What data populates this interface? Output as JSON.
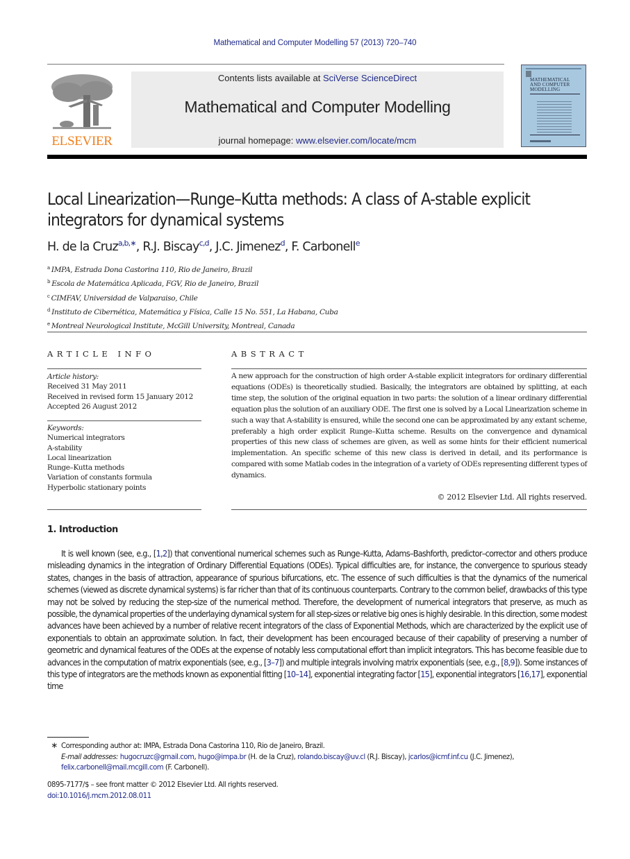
{
  "running_head": "Mathematical and Computer Modelling 57 (2013) 720–740",
  "masthead": {
    "publisher_logo": "ELSEVIER",
    "contents_prefix": "Contents lists available at ",
    "contents_link": "SciVerse ScienceDirect",
    "journal_title": "Mathematical and Computer Modelling",
    "homepage_prefix": "journal homepage: ",
    "homepage_link": "www.elsevier.com/locate/mcm",
    "cover_title_lines": [
      "MATHEMATICAL",
      "AND COMPUTER",
      "MODELLING"
    ],
    "colors": {
      "elsevier_orange": "#f07f1b",
      "link_blue": "#1f2a8a",
      "banner_gray": "#ececec",
      "cover_blue": "#a8c8e0"
    }
  },
  "article": {
    "title": "Local Linearization—Runge–Kutta methods: A class of A-stable explicit integrators for dynamical systems",
    "authors": [
      {
        "name": "H. de la Cruz",
        "sup": "a,b,∗",
        "sep": ", "
      },
      {
        "name": "R.J. Biscay",
        "sup": "c,d",
        "sep": ", "
      },
      {
        "name": "J.C. Jimenez",
        "sup": "d",
        "sep": ", "
      },
      {
        "name": "F. Carbonell",
        "sup": "e",
        "sep": ""
      }
    ],
    "affiliations": [
      {
        "mark": "a",
        "text": "IMPA, Estrada Dona Castorina 110, Rio de Janeiro, Brazil"
      },
      {
        "mark": "b",
        "text": "Escola de Matemática Aplicada, FGV, Rio de Janeiro, Brazil"
      },
      {
        "mark": "c",
        "text": "CIMFAV, Universidad de Valparaiso, Chile"
      },
      {
        "mark": "d",
        "text": "Instituto de Cibernética, Matemática y Física, Calle 15 No. 551, La Habana, Cuba"
      },
      {
        "mark": "e",
        "text": "Montreal Neurological Institute, McGill University, Montreal, Canada"
      }
    ]
  },
  "article_info": {
    "heading": "ARTICLE INFO",
    "history_label": "Article history:",
    "history": [
      "Received 31 May 2011",
      "Received in revised form 15 January 2012",
      "Accepted 26 August 2012"
    ],
    "keywords_label": "Keywords:",
    "keywords": [
      "Numerical integrators",
      "A-stability",
      "Local linearization",
      "Runge–Kutta methods",
      "Variation of constants formula",
      "Hyperbolic stationary points"
    ]
  },
  "abstract": {
    "heading": "ABSTRACT",
    "text": "A new approach for the construction of high order A-stable explicit integrators for ordinary differential equations (ODEs) is theoretically studied. Basically, the integrators are obtained by splitting, at each time step, the solution of the original equation in two parts: the solution of a linear ordinary differential equation plus the solution of an auxiliary ODE. The first one is solved by a Local Linearization scheme in such a way that A-stability is ensured, while the second one can be approximated by any extant scheme, preferably a high order explicit Runge–Kutta scheme. Results on the convergence and dynamical properties of this new class of schemes are given, as well as some hints for their efficient numerical implementation. An specific scheme of this new class is derived in detail, and its performance is compared with some Matlab codes in the integration of a variety of ODEs representing different types of dynamics.",
    "copyright": "© 2012 Elsevier Ltd. All rights reserved."
  },
  "introduction": {
    "heading": "1.  Introduction",
    "segments": [
      {
        "t": "It is well known (see, e.g., ["
      },
      {
        "t": "1",
        "ref": true
      },
      {
        "t": ","
      },
      {
        "t": "2",
        "ref": true
      },
      {
        "t": "]) that conventional numerical schemes such as Runge–Kutta, Adams–Bashforth, predictor–corrector and others produce misleading dynamics in the integration of Ordinary Differential Equations (ODEs). Typical difficulties are, for instance, the convergence to spurious steady states, changes in the basis of attraction, appearance of spurious bifurcations, etc. The essence of such difficulties is that the dynamics of the numerical schemes (viewed as discrete dynamical systems) is far richer than that of its continuous counterparts. Contrary to the common belief, drawbacks of this type may not be solved by reducing the step-size of the numerical method. Therefore, the development of numerical integrators that preserve, as much as possible, the dynamical properties of the underlaying dynamical system for all step-sizes or relative big ones is highly desirable. In this direction, some modest advances have been achieved by a number of relative recent integrators of the class of Exponential Methods, which are characterized by the explicit use of exponentials to obtain an approximate solution. In fact, their development has been encouraged because of their capability of preserving a number of geometric and dynamical features of the ODEs at the expense of notably less computational effort than implicit integrators. This has become feasible due to advances in the computation of matrix exponentials (see, e.g., ["
      },
      {
        "t": "3–7",
        "ref": true
      },
      {
        "t": "]) and multiple integrals involving matrix exponentials (see, e.g., ["
      },
      {
        "t": "8",
        "ref": true
      },
      {
        "t": ","
      },
      {
        "t": "9",
        "ref": true
      },
      {
        "t": "]). Some instances of this type of integrators are the methods known as exponential fitting ["
      },
      {
        "t": "10–14",
        "ref": true
      },
      {
        "t": "], exponential integrating factor ["
      },
      {
        "t": "15",
        "ref": true
      },
      {
        "t": "], exponential integrators ["
      },
      {
        "t": "16",
        "ref": true
      },
      {
        "t": ","
      },
      {
        "t": "17",
        "ref": true
      },
      {
        "t": "], exponential time"
      }
    ]
  },
  "footnotes": {
    "star": "∗",
    "corresponding": "Corresponding author at: IMPA, Estrada Dona Castorina 110, Rio de Janeiro, Brazil.",
    "email_label": "E-mail addresses:",
    "emails": [
      {
        "addr": "hugocruzc@gmail.com",
        "after": ", "
      },
      {
        "addr": "hugo@impa.br",
        "after": " (H. de la Cruz), "
      },
      {
        "addr": "rolando.biscay@uv.cl",
        "after": " (R.J. Biscay), "
      },
      {
        "addr": "jcarlos@icmf.inf.cu",
        "after": " (J.C. Jimenez), "
      },
      {
        "addr": "felix.carbonell@mail.mcgill.com",
        "after": " (F. Carbonell)."
      }
    ]
  },
  "front_matter": {
    "issn_line": "0895-7177/$ – see front matter © 2012 Elsevier Ltd. All rights reserved.",
    "doi": "doi:10.1016/j.mcm.2012.08.011"
  }
}
